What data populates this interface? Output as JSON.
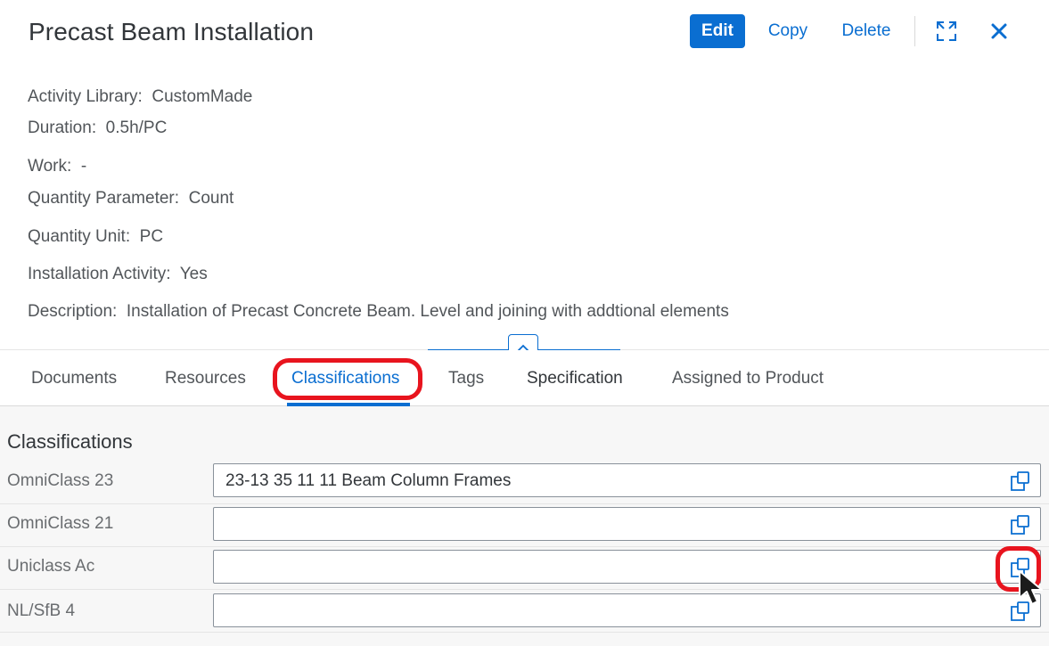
{
  "header": {
    "title": "Precast Beam Installation",
    "actions": {
      "edit_label": "Edit",
      "copy_label": "Copy",
      "delete_label": "Delete",
      "expand_icon": "fullscreen-icon",
      "close_icon": "close-icon"
    },
    "attributes": [
      {
        "key": "Activity Library:",
        "value": "CustomMade"
      },
      {
        "key": "Duration:",
        "value": "0.5h/PC"
      },
      {
        "key": "Work:",
        "value": "-"
      },
      {
        "key": "Quantity Parameter:",
        "value": "Count"
      },
      {
        "key": "Quantity Unit:",
        "value": "PC"
      },
      {
        "key": "Installation Activity:",
        "value": "Yes"
      },
      {
        "key": "Description:",
        "value": "Installation of Precast Concrete Beam. Level and joining with addtional elements"
      }
    ],
    "collapse_icon": "chevron-up-icon"
  },
  "tabs": [
    {
      "label": "Documents",
      "active": false
    },
    {
      "label": "Resources",
      "active": false
    },
    {
      "label": "Classifications",
      "active": true
    },
    {
      "label": "Tags",
      "active": false
    },
    {
      "label": "Specification",
      "active": false
    },
    {
      "label": "Assigned to Product",
      "active": false
    }
  ],
  "classifications": {
    "section_title": "Classifications",
    "rows": [
      {
        "label": "OmniClass 23",
        "value": "23-13 35 11 11 Beam Column Frames"
      },
      {
        "label": "OmniClass 21",
        "value": ""
      },
      {
        "label": "Uniclass Ac",
        "value": ""
      },
      {
        "label": "NL/SfB 4",
        "value": ""
      }
    ],
    "value_help_icon": "value-help-icon"
  },
  "colors": {
    "accent": "#0a6ed1",
    "highlight": "#e8141e",
    "text": "#32363a"
  }
}
